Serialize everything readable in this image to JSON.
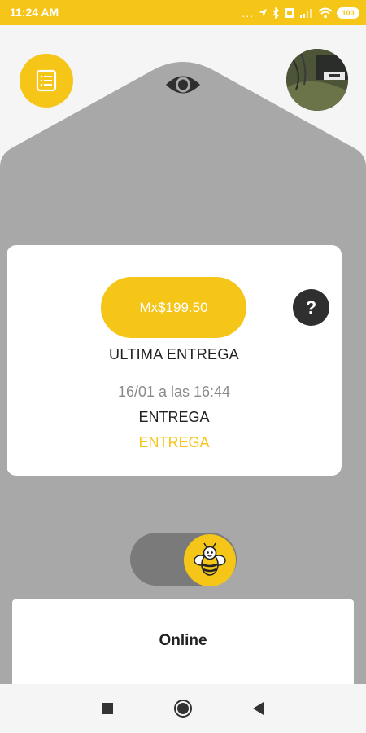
{
  "status_bar": {
    "time": "11:24 AM",
    "dots": "...",
    "battery": "100"
  },
  "icons": {
    "menu": "list-icon",
    "eye": "eye-icon",
    "help": "question-icon",
    "bee": "bee-icon"
  },
  "card": {
    "amount": "Mx$199.50",
    "help_label": "?",
    "last_delivery_label": "ULTIMA ENTREGA",
    "date": "16/01 a las 16:44",
    "delivery_type": "ENTREGA",
    "delivery_status": "ENTREGA"
  },
  "online": {
    "label": "Online"
  },
  "colors": {
    "accent": "#f5c518",
    "background_shape": "#a8a8a8",
    "dark": "#2f2f2f"
  }
}
